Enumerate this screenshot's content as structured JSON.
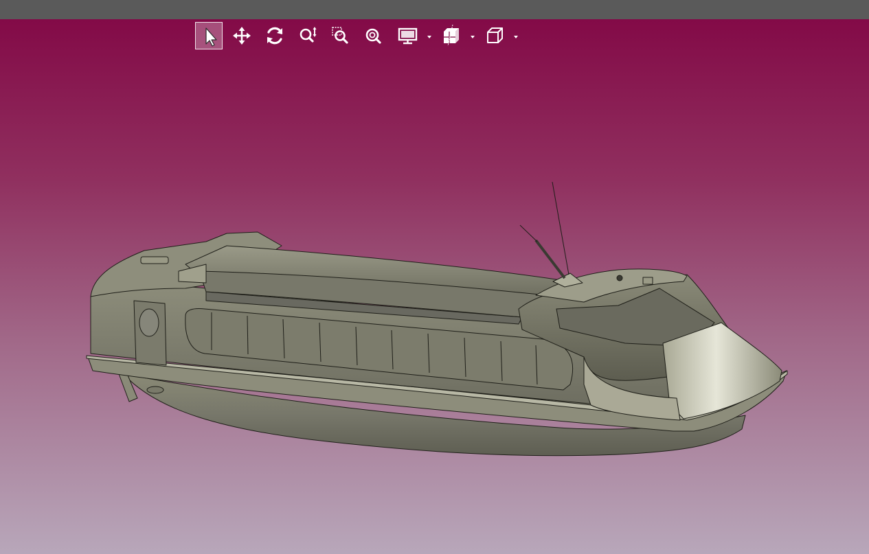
{
  "toolbar": {
    "tools": [
      {
        "id": "select",
        "icon": "cursor-arrow-icon",
        "active": true
      },
      {
        "id": "pan",
        "icon": "move-arrows-icon",
        "active": false
      },
      {
        "id": "rotate",
        "icon": "rotate-icon",
        "active": false
      },
      {
        "id": "zoom",
        "icon": "zoom-updown-icon",
        "active": false
      },
      {
        "id": "zoom-window",
        "icon": "zoom-window-icon",
        "active": false
      },
      {
        "id": "zoom-fit",
        "icon": "zoom-fit-icon",
        "active": false
      },
      {
        "id": "display-mode",
        "icon": "monitor-icon",
        "has_dropdown": true
      },
      {
        "id": "section",
        "icon": "section-plane-icon",
        "has_dropdown": true
      },
      {
        "id": "view-orientation",
        "icon": "cube-icon",
        "has_dropdown": true
      }
    ]
  },
  "viewport": {
    "background_colors": [
      "#830a47",
      "#b8a7ba"
    ],
    "model": "boat-3d-model"
  },
  "colors": {
    "titlebar": "#5a5a5a",
    "hull": "#7a7a68",
    "hull_highlight": "#c9c9b8",
    "edge_lines": "#1e1e18"
  }
}
